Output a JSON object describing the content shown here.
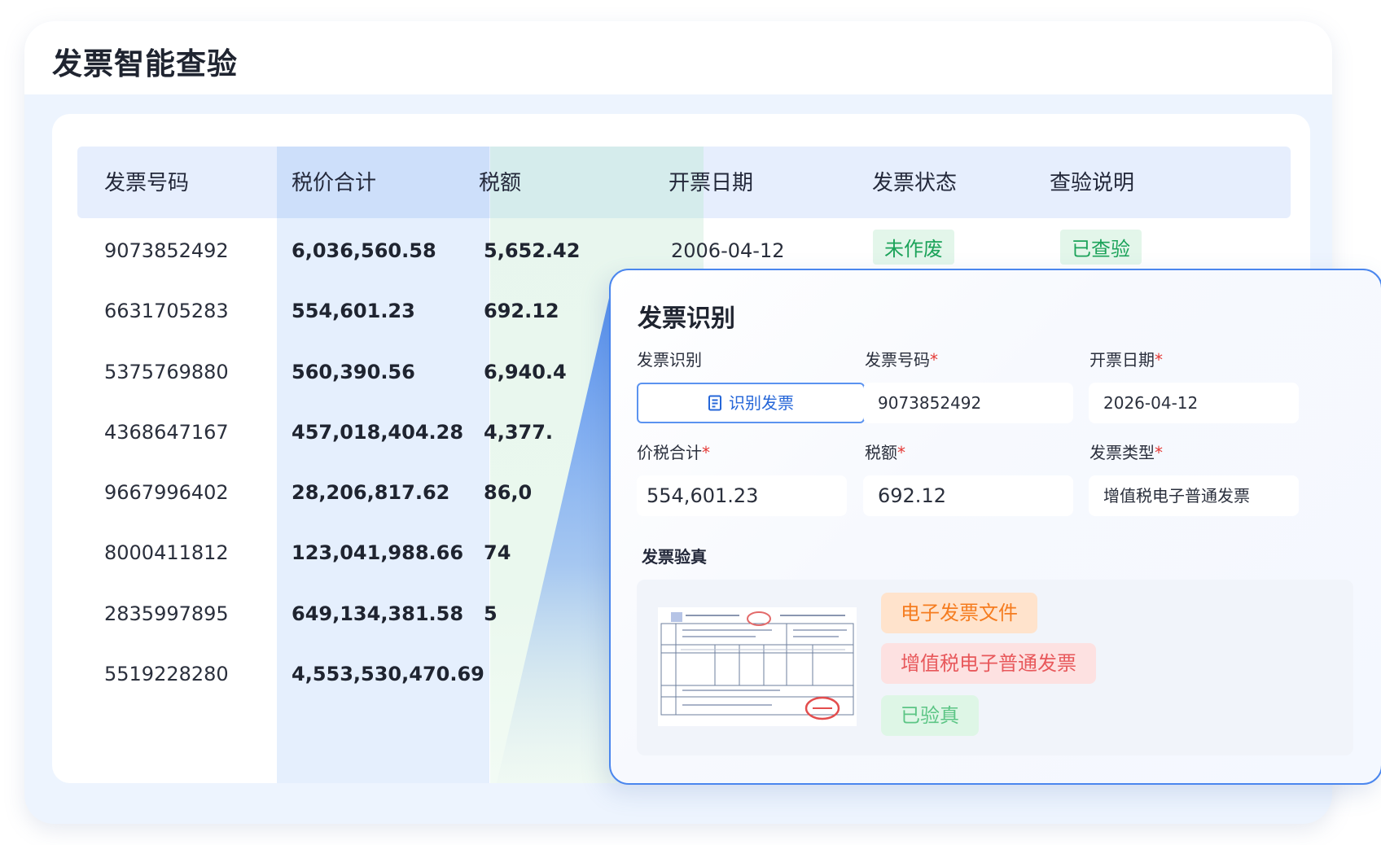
{
  "page_title": "发票智能查验",
  "table": {
    "headers": [
      "发票号码",
      "税价合计",
      "税额",
      "开票日期",
      "发票状态",
      "查验说明"
    ],
    "rows": [
      {
        "number": "9073852492",
        "total": "6,036,560.58",
        "tax": "5,652.42",
        "date": "2006-04-12",
        "status": "未作废",
        "note": "已查验"
      },
      {
        "number": "6631705283",
        "total": "554,601.23",
        "tax": "692.12"
      },
      {
        "number": "5375769880",
        "total": "560,390.56",
        "tax": "6,940.4"
      },
      {
        "number": "4368647167",
        "total": "457,018,404.28",
        "tax": "4,377."
      },
      {
        "number": "9667996402",
        "total": "28,206,817.62",
        "tax": "86,0"
      },
      {
        "number": "8000411812",
        "total": "123,041,988.66",
        "tax": "74"
      },
      {
        "number": "2835997895",
        "total": "649,134,381.58",
        "tax": "5"
      },
      {
        "number": "5519228280",
        "total": "4,553,530,470.69",
        "tax": ""
      }
    ]
  },
  "popup": {
    "title": "发票识别",
    "recognize_label": "发票识别",
    "recognize_button": "识别发票",
    "invoice_number_label": "发票号码",
    "invoice_number_value": "9073852492",
    "issue_date_label": "开票日期",
    "issue_date_value": "2026-04-12",
    "total_label": "价税合计",
    "total_value": "554,601.23",
    "tax_label": "税额",
    "tax_value": "692.12",
    "type_label": "发票类型",
    "type_value": "增值税电子普通发票",
    "required_mark": "*",
    "verify_label": "发票验真",
    "tags": [
      "电子发票文件",
      "增值税电子普通发票",
      "已验真"
    ]
  },
  "colors": {
    "accent": "#4a86ee",
    "status_green": "#1ca35a",
    "tag_orange": "#f57c1f",
    "tag_red": "#e8585b",
    "tag_green": "#5cc585"
  }
}
